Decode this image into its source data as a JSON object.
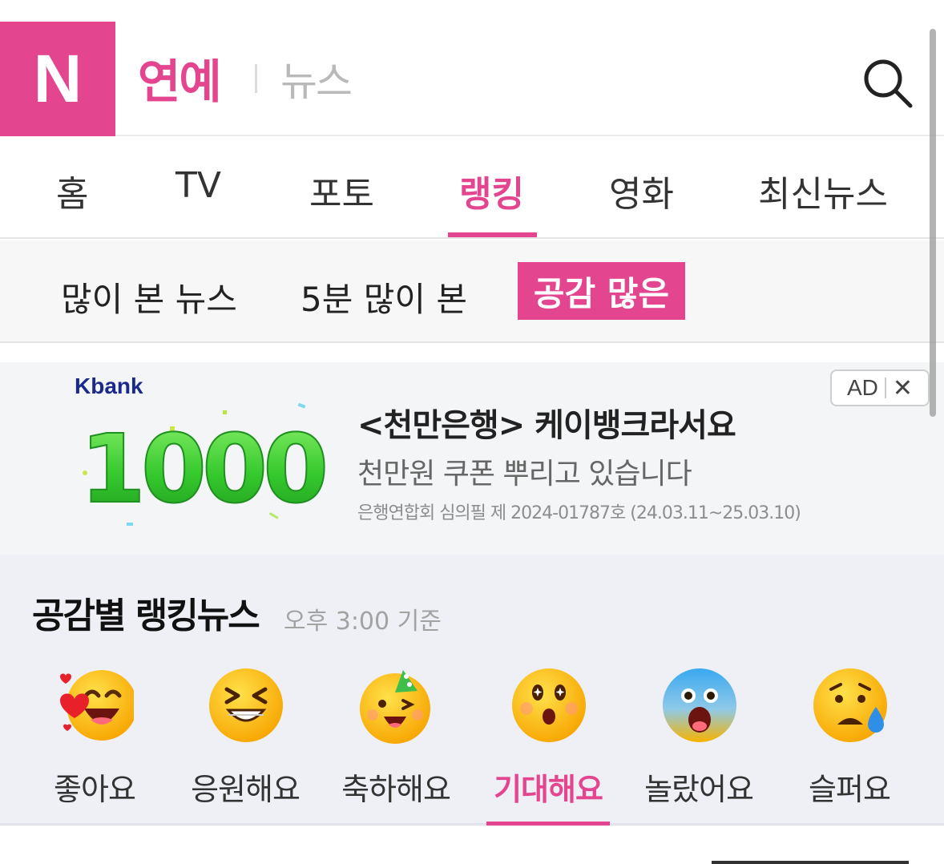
{
  "header": {
    "logo_text": "N",
    "brand": "연예",
    "sub_brand": "뉴스",
    "search_icon": "search-icon"
  },
  "nav": {
    "tabs": [
      {
        "label": "홈"
      },
      {
        "label": "TV"
      },
      {
        "label": "포토"
      },
      {
        "label": "랭킹",
        "active": true
      },
      {
        "label": "영화"
      },
      {
        "label": "최신뉴스"
      }
    ]
  },
  "subnav": {
    "tabs": [
      {
        "label": "많이 본 뉴스"
      },
      {
        "label": "5분 많이 본"
      },
      {
        "label": "공감 많은",
        "active": true
      }
    ]
  },
  "ad": {
    "advertiser": "Kbank",
    "graphic_text": "1000",
    "headline": "<천만은행> 케이뱅크라서요",
    "subline": "천만원 쿠폰 뿌리고 있습니다",
    "legal": "은행연합회 심의필 제 2024-01787호 (24.03.11~25.03.10)",
    "badge_label": "AD",
    "close_glyph": "✕"
  },
  "ranking": {
    "title": "공감별 랭킹뉴스",
    "time": "오후 3:00 기준",
    "reactions": [
      {
        "label": "좋아요",
        "icon": "heart-eyes-emoji-icon"
      },
      {
        "label": "응원해요",
        "icon": "grinning-squint-emoji-icon"
      },
      {
        "label": "축하해요",
        "icon": "party-emoji-icon"
      },
      {
        "label": "기대해요",
        "icon": "starry-eyed-emoji-icon",
        "active": true
      },
      {
        "label": "놀랐어요",
        "icon": "shocked-emoji-icon"
      },
      {
        "label": "슬퍼요",
        "icon": "sad-tear-emoji-icon"
      }
    ]
  },
  "colors": {
    "accent": "#e3468f",
    "ad_green": "#3fd43a",
    "kbank_blue": "#1a2a8c"
  }
}
